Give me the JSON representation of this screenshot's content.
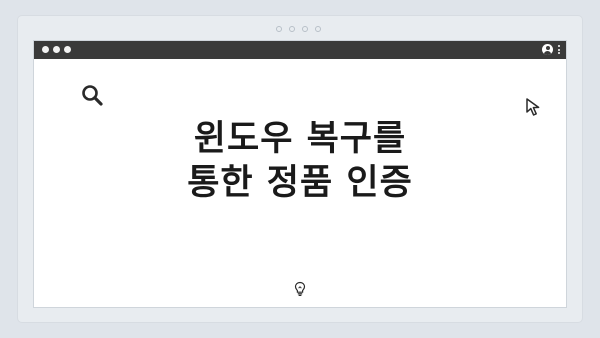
{
  "headline": {
    "line1": "윈도우 복구를",
    "line2": "통한 정품 인증"
  },
  "icons": {
    "search": "search-icon",
    "cursor": "cursor-icon",
    "user": "user-icon",
    "menu": "kebab-menu-icon",
    "idea": "lightbulb-icon"
  },
  "colors": {
    "background": "#dfe4ea",
    "titlebar": "#3a3a3a",
    "window": "#ffffff",
    "text": "#1a1a1a"
  }
}
